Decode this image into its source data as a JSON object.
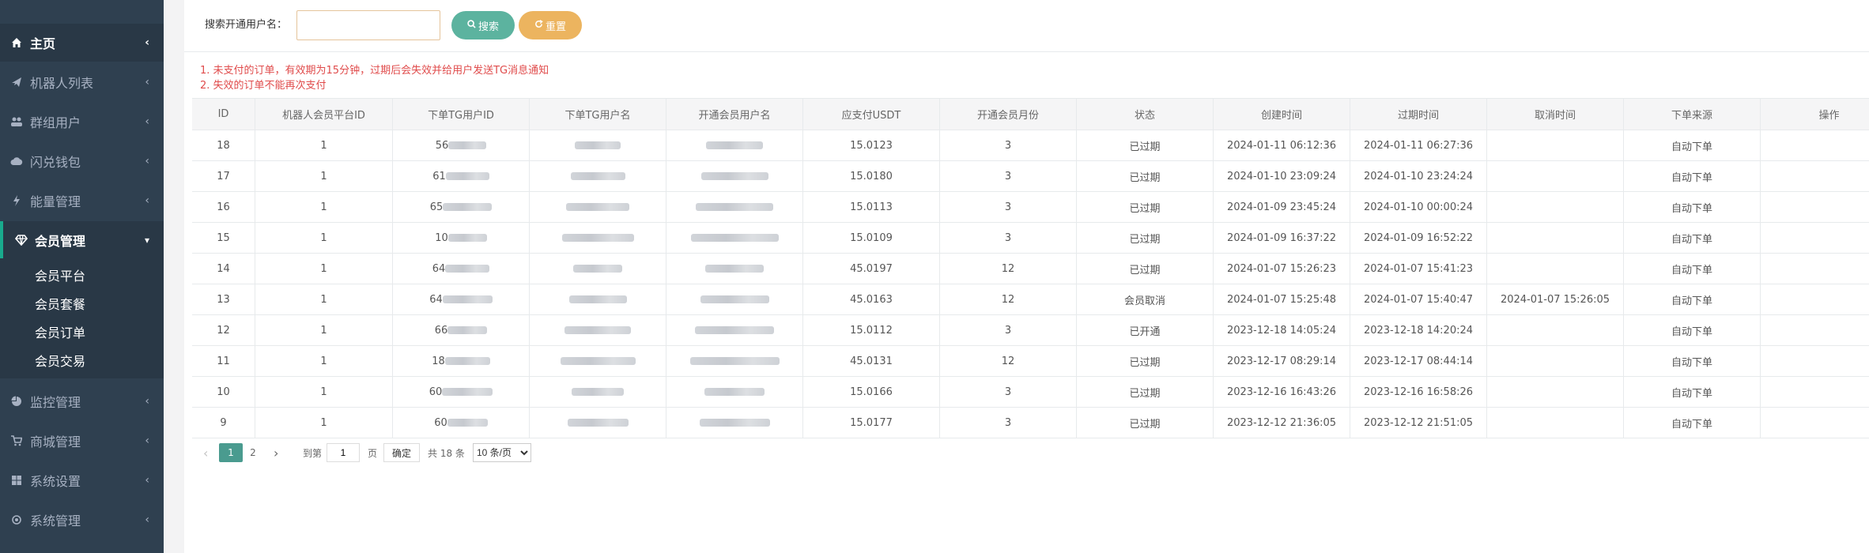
{
  "sidebar": {
    "items": [
      {
        "label": "主页",
        "icon": "home-icon"
      },
      {
        "label": "机器人列表",
        "icon": "plane-icon"
      },
      {
        "label": "群组用户",
        "icon": "users-icon"
      },
      {
        "label": "闪兑钱包",
        "icon": "cloud-icon"
      },
      {
        "label": "能量管理",
        "icon": "bolt-icon"
      },
      {
        "label": "会员管理",
        "icon": "diamond-icon"
      },
      {
        "label": "监控管理",
        "icon": "pie-icon"
      },
      {
        "label": "商城管理",
        "icon": "cart-icon"
      },
      {
        "label": "系统设置",
        "icon": "windows-icon"
      },
      {
        "label": "系统管理",
        "icon": "gear-icon"
      }
    ],
    "sub_items": [
      {
        "label": "会员平台"
      },
      {
        "label": "会员套餐"
      },
      {
        "label": "会员订单"
      },
      {
        "label": "会员交易"
      }
    ]
  },
  "search": {
    "label": "搜索开通用户名：",
    "input_value": "",
    "search_button": "搜索",
    "reset_button": "重置"
  },
  "notices": [
    "1. 未支付的订单，有效期为15分钟，过期后会失效并给用户发送TG消息通知",
    "2. 失效的订单不能再次支付"
  ],
  "table": {
    "headers": [
      "ID",
      "机器人会员平台ID",
      "下单TG用户ID",
      "下单TG用户名",
      "开通会员用户名",
      "应支付USDT",
      "开通会员月份",
      "状态",
      "创建时间",
      "过期时间",
      "取消时间",
      "下单来源",
      "操作"
    ],
    "rows": [
      {
        "id": "18",
        "platform_id": "1",
        "uid_prefix": "56",
        "usdt": "15.0123",
        "months": "3",
        "status": "已过期",
        "created": "2024-01-11 06:12:36",
        "expired": "2024-01-11 06:27:36",
        "cancelled": "",
        "source": "自动下单"
      },
      {
        "id": "17",
        "platform_id": "1",
        "uid_prefix": "61",
        "usdt": "15.0180",
        "months": "3",
        "status": "已过期",
        "created": "2024-01-10 23:09:24",
        "expired": "2024-01-10 23:24:24",
        "cancelled": "",
        "source": "自动下单"
      },
      {
        "id": "16",
        "platform_id": "1",
        "uid_prefix": "65",
        "usdt": "15.0113",
        "months": "3",
        "status": "已过期",
        "created": "2024-01-09 23:45:24",
        "expired": "2024-01-10 00:00:24",
        "cancelled": "",
        "source": "自动下单"
      },
      {
        "id": "15",
        "platform_id": "1",
        "uid_prefix": "10",
        "usdt": "15.0109",
        "months": "3",
        "status": "已过期",
        "created": "2024-01-09 16:37:22",
        "expired": "2024-01-09 16:52:22",
        "cancelled": "",
        "source": "自动下单"
      },
      {
        "id": "14",
        "platform_id": "1",
        "uid_prefix": "64",
        "usdt": "45.0197",
        "months": "12",
        "status": "已过期",
        "created": "2024-01-07 15:26:23",
        "expired": "2024-01-07 15:41:23",
        "cancelled": "",
        "source": "自动下单"
      },
      {
        "id": "13",
        "platform_id": "1",
        "uid_prefix": "64",
        "usdt": "45.0163",
        "months": "12",
        "status": "会员取消",
        "created": "2024-01-07 15:25:48",
        "expired": "2024-01-07 15:40:47",
        "cancelled": "2024-01-07 15:26:05",
        "source": "自动下单"
      },
      {
        "id": "12",
        "platform_id": "1",
        "uid_prefix": "66",
        "usdt": "15.0112",
        "months": "3",
        "status": "已开通",
        "created": "2023-12-18 14:05:24",
        "expired": "2023-12-18 14:20:24",
        "cancelled": "",
        "source": "自动下单"
      },
      {
        "id": "11",
        "platform_id": "1",
        "uid_prefix": "18",
        "usdt": "45.0131",
        "months": "12",
        "status": "已过期",
        "created": "2023-12-17 08:29:14",
        "expired": "2023-12-17 08:44:14",
        "cancelled": "",
        "source": "自动下单"
      },
      {
        "id": "10",
        "platform_id": "1",
        "uid_prefix": "60",
        "usdt": "15.0166",
        "months": "3",
        "status": "已过期",
        "created": "2023-12-16 16:43:26",
        "expired": "2023-12-16 16:58:26",
        "cancelled": "",
        "source": "自动下单"
      },
      {
        "id": "9",
        "platform_id": "1",
        "uid_prefix": "60",
        "usdt": "15.0177",
        "months": "3",
        "status": "已过期",
        "created": "2023-12-12 21:36:05",
        "expired": "2023-12-12 21:51:05",
        "cancelled": "",
        "source": "自动下单"
      }
    ]
  },
  "pagination": {
    "pages": [
      "1",
      "2"
    ],
    "current_page": "1",
    "goto_label": "到第",
    "goto_value": "1",
    "page_unit": "页",
    "confirm": "确定",
    "total": "共 18 条",
    "page_size": "10 条/页"
  }
}
